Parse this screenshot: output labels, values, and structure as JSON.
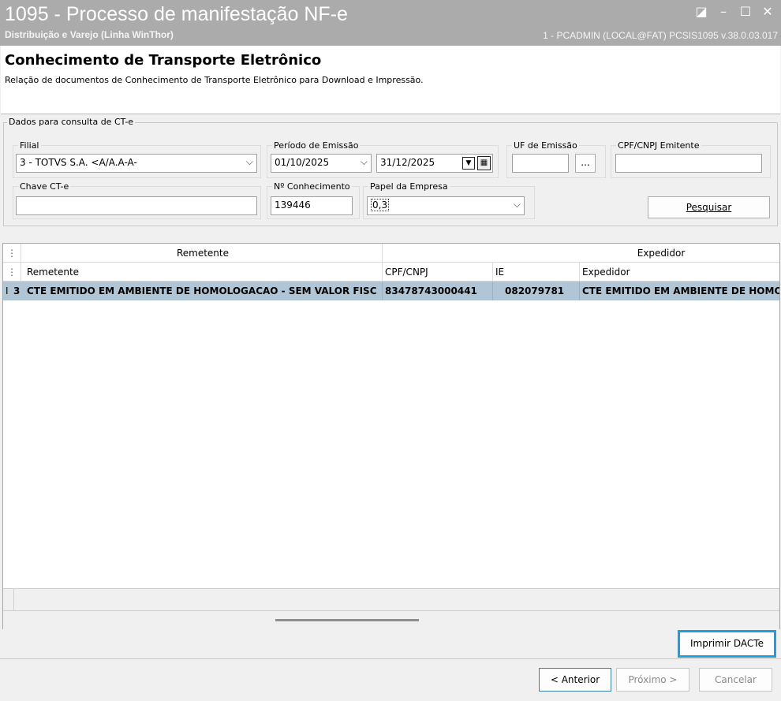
{
  "window": {
    "title": "1095 - Processo de manifestação NF-e",
    "subtitle": "Distribuição e Varejo (Linha WinThor)",
    "session_info": "1 - PCADMIN (LOCAL@FAT)   PCSIS1095  v.38.0.03.017",
    "controls": {
      "restore": "◪",
      "minimize": "–",
      "maximize": "☐",
      "close": "✕"
    }
  },
  "header": {
    "title": "Conhecimento de Transporte Eletrônico",
    "description": "Relação de documentos de Conhecimento de Transporte Eletrônico para Download e Impressão."
  },
  "form": {
    "legend": "Dados para consulta de CT-e",
    "filial_label": "Filial",
    "filial_value": "3 - TOTVS S.A.  <A/A.A-A-",
    "periodo_label": "Período de Emissão",
    "periodo_inicio": "01/10/2025",
    "periodo_fim": "31/12/2025",
    "uf_label": "UF de Emissão",
    "uf_value": "",
    "uf_button": "...",
    "cpf_label": "CPF/CNPJ Emitente",
    "cpf_value": "",
    "chave_label": "Chave CT-e",
    "chave_value": "",
    "conhecimento_label": "Nº Conhecimento",
    "conhecimento_value": "139446",
    "papel_label": "Papel da Empresa",
    "papel_value": "0,3",
    "pesquisar_button": "Pesquisar"
  },
  "grid": {
    "group_headers": [
      "Remetente",
      "Expedidor"
    ],
    "columns": [
      "Remetente",
      "CPF/CNPJ",
      "IE",
      "Expedidor"
    ],
    "rows": [
      {
        "marker": "I",
        "index": "3",
        "remetente": "CTE EMITIDO EM AMBIENTE DE HOMOLOGACAO - SEM VALOR FISC",
        "cpf_cnpj": "83478743000441",
        "ie": "082079781",
        "expedidor": "CTE EMITIDO EM AMBIENTE DE HOMOLOGACAO - SEM VALOR FISCAL"
      }
    ]
  },
  "actions": {
    "imprimir": "Imprimir DACTe",
    "anterior": "< Anterior",
    "proximo": "Próximo >",
    "cancelar": "Cancelar"
  },
  "colors": {
    "titlebar": "#ababab",
    "selected_row": "#b0c6d6",
    "highlight_border": "#1e9ee0"
  }
}
